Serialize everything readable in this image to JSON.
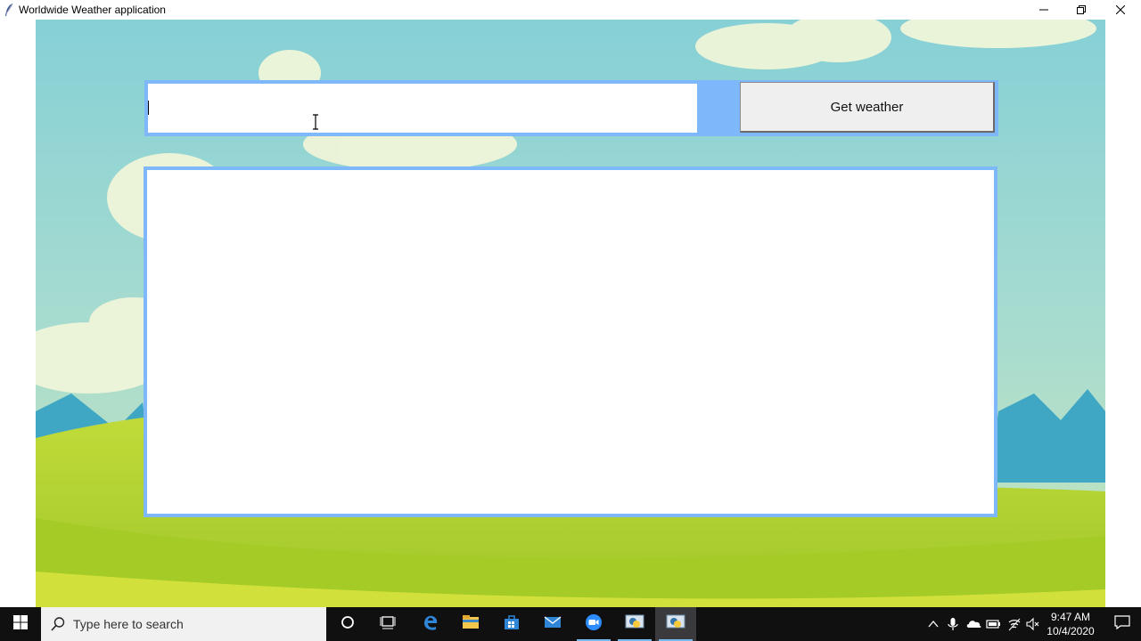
{
  "window": {
    "title": "Worldwide Weather application",
    "app_icon": "feather-icon",
    "controls": [
      "minimize-icon",
      "restore-icon",
      "close-icon"
    ]
  },
  "form": {
    "city_input_value": "",
    "get_weather_label": "Get weather",
    "result_text": ""
  },
  "colors": {
    "frame_accent": "#7fb7fb",
    "sky_top": "#8dd4d8",
    "hill_green": "#b6d630",
    "taskbar": "#101011"
  },
  "taskbar": {
    "search_placeholder": "Type here to search",
    "pinned": [
      "cortana-icon",
      "task-view-icon",
      "edge-icon",
      "file-explorer-icon",
      "store-icon",
      "mail-icon",
      "zoom-icon",
      "python-idle-icon",
      "python-app-icon"
    ],
    "tray": [
      "chevron-up-icon",
      "microphone-icon",
      "onedrive-icon",
      "battery-icon",
      "wifi-icon",
      "volume-muted-icon"
    ],
    "time": "9:47 AM",
    "date": "10/4/2020"
  }
}
